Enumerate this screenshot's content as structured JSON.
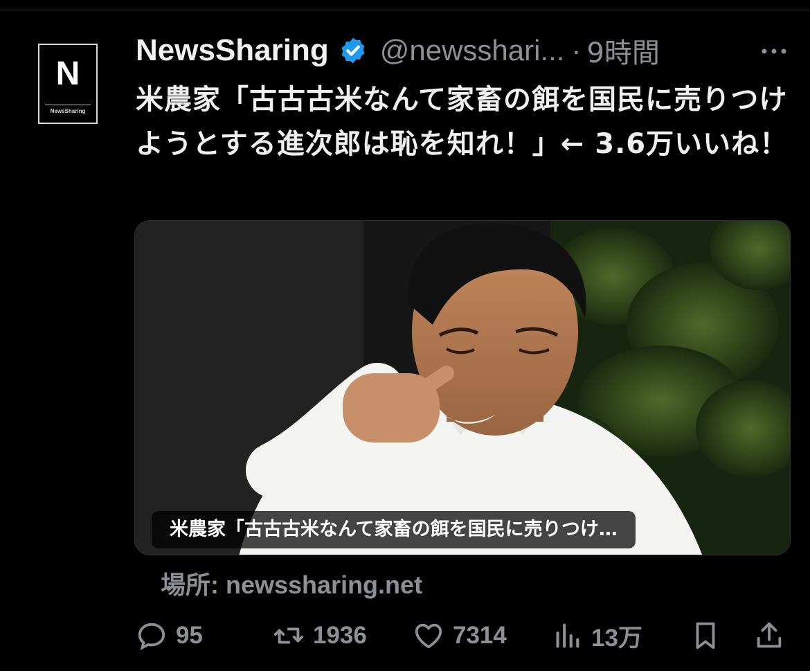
{
  "tweet": {
    "author_name": "NewsSharing",
    "handle": "@newsshari...",
    "separator": "·",
    "time": "9時間",
    "avatar": {
      "letter": "N",
      "wordmark": "NewsSharing"
    },
    "text": "米農家「古古古米なんて家畜の餌を国民に売りつけようとする進次郎は恥を知れ！」← 3.6万いいね！",
    "card": {
      "label": "米農家「古古古米なんて家畜の餌を国民に売りつけ…"
    },
    "source": "場所: newssharing.net"
  },
  "actions": {
    "reply_count": "95",
    "retweet_count": "1936",
    "like_count": "7314",
    "views_count": "13万"
  },
  "colors": {
    "background": "#000000",
    "text": "#e7e9ea",
    "muted": "#8b9096",
    "verified": "#1d9bf0"
  },
  "icons": [
    "more-icon",
    "verified-icon",
    "reply-icon",
    "retweet-icon",
    "like-icon",
    "views-icon",
    "bookmark-icon",
    "share-icon"
  ]
}
